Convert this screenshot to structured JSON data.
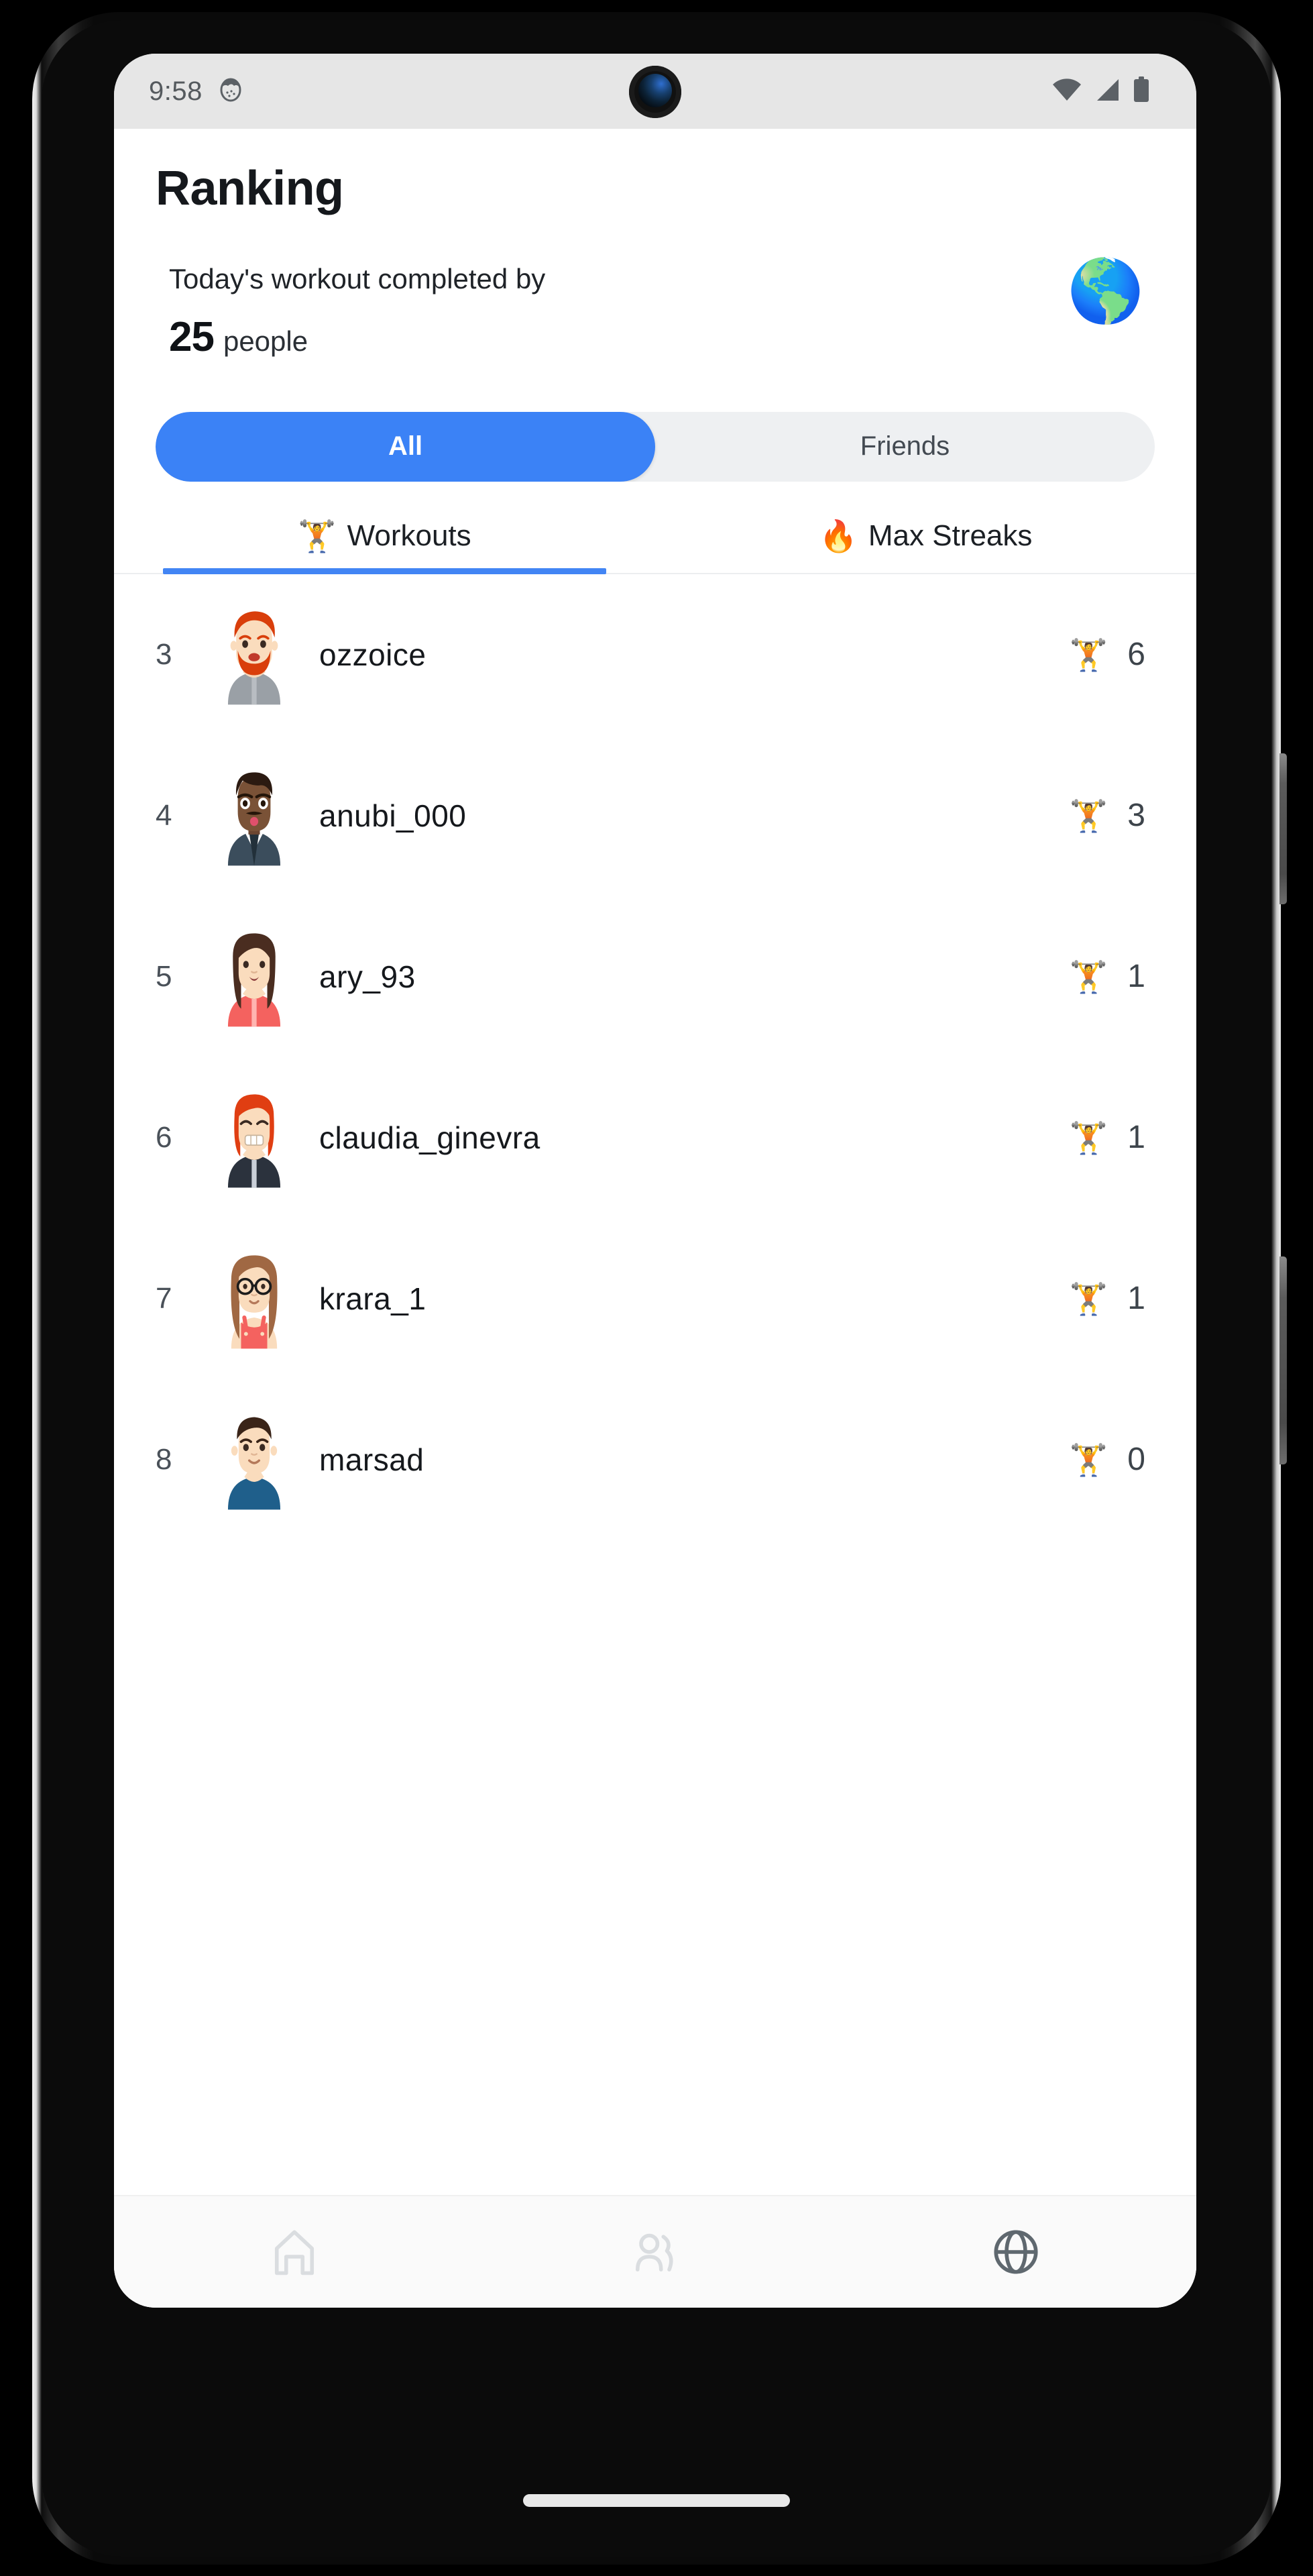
{
  "status_bar": {
    "clock": "9:58",
    "notification_icon": "notification-dot-icon",
    "wifi_icon": "wifi-icon",
    "signal_icon": "cellular-signal-icon",
    "battery_icon": "battery-icon"
  },
  "header": {
    "title": "Ranking"
  },
  "summary": {
    "caption": "Today's workout completed by",
    "count": "25",
    "unit": "people",
    "globe_emoji": "🌎"
  },
  "segmented": {
    "options": [
      {
        "label": "All",
        "active": true
      },
      {
        "label": "Friends",
        "active": false
      }
    ],
    "active_color": "#3b82f6",
    "track_color": "#eef0f2"
  },
  "subtabs": {
    "items": [
      {
        "emoji": "🏋️",
        "label": "Workouts",
        "active": true
      },
      {
        "emoji": "🔥",
        "label": "Max Streaks",
        "active": false
      }
    ],
    "underline_color": "#4285f4"
  },
  "ranking": {
    "score_emoji": "🏋️",
    "rows": [
      {
        "position": "3",
        "name": "ozzoice",
        "score": "6",
        "avatar": "avatar-redbeard-gray-hoodie"
      },
      {
        "position": "4",
        "name": "anubi_000",
        "score": "3",
        "avatar": "avatar-mustache-navy-suit"
      },
      {
        "position": "5",
        "name": "ary_93",
        "score": "1",
        "avatar": "avatar-darkhair-coral-hoodie"
      },
      {
        "position": "6",
        "name": "claudia_ginevra",
        "score": "1",
        "avatar": "avatar-redhair-navy-hoodie"
      },
      {
        "position": "7",
        "name": "krara_1",
        "score": "1",
        "avatar": "avatar-glasses-coral-overalls"
      },
      {
        "position": "8",
        "name": "marsad",
        "score": "0",
        "avatar": "avatar-shorthair-blue-shirt"
      }
    ]
  },
  "bottom_nav": {
    "items": [
      {
        "icon": "home-icon",
        "active": false
      },
      {
        "icon": "friends-icon",
        "active": false
      },
      {
        "icon": "globe-icon",
        "active": true
      }
    ],
    "active_color": "#5f686f",
    "inactive_color": "#dadde0"
  }
}
